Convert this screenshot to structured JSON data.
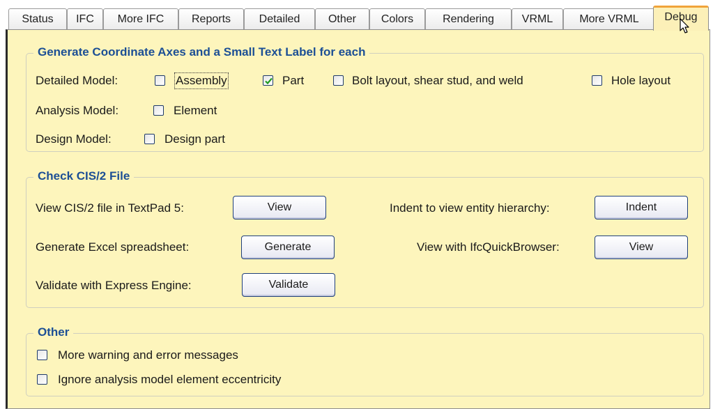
{
  "tabs": [
    {
      "label": "Status",
      "active": false
    },
    {
      "label": "IFC",
      "active": false
    },
    {
      "label": "More IFC",
      "active": false
    },
    {
      "label": "Reports",
      "active": false
    },
    {
      "label": "Detailed",
      "active": false
    },
    {
      "label": "Other",
      "active": false
    },
    {
      "label": "Colors",
      "active": false
    },
    {
      "label": "Rendering",
      "active": false
    },
    {
      "label": "VRML",
      "active": false
    },
    {
      "label": "More VRML",
      "active": false
    },
    {
      "label": "Debug",
      "active": true
    }
  ],
  "coordinate_axes": {
    "title": "Generate Coordinate Axes and a Small Text Label for each",
    "detailed_model_label": "Detailed Model:",
    "assembly": {
      "label": "Assembly",
      "checked": false
    },
    "part": {
      "label": "Part",
      "checked": true
    },
    "bolt_layout": {
      "label": "Bolt layout, shear stud, and weld",
      "checked": false
    },
    "hole_layout": {
      "label": "Hole layout",
      "checked": false
    },
    "analysis_model_label": "Analysis Model:",
    "element": {
      "label": "Element",
      "checked": false
    },
    "design_model_label": "Design Model:",
    "design_part": {
      "label": "Design part",
      "checked": false
    }
  },
  "check_file": {
    "title": "Check CIS/2 File",
    "view_textpad_label": "View CIS/2 file in TextPad 5:",
    "view_textpad_button": "View",
    "excel_label": "Generate Excel spreadsheet:",
    "excel_button": "Generate",
    "validate_label": "Validate with Express Engine:",
    "validate_button": "Validate",
    "indent_label": "Indent to view entity hierarchy:",
    "indent_button": "Indent",
    "quickbrowser_label": "View with IfcQuickBrowser:",
    "quickbrowser_button": "View"
  },
  "other": {
    "title": "Other",
    "more_warnings": {
      "label": "More warning and error messages",
      "checked": false
    },
    "ignore_eccentricity": {
      "label": "Ignore analysis model element eccentricity",
      "checked": false
    }
  },
  "colors": {
    "panel_bg": "#fdf5bc",
    "legend_text": "#1c4f95",
    "active_tab_accent": "#f0a33a"
  },
  "icons": {
    "cursor": "arrow-pointer-icon",
    "checkmark": "checkmark-icon"
  }
}
